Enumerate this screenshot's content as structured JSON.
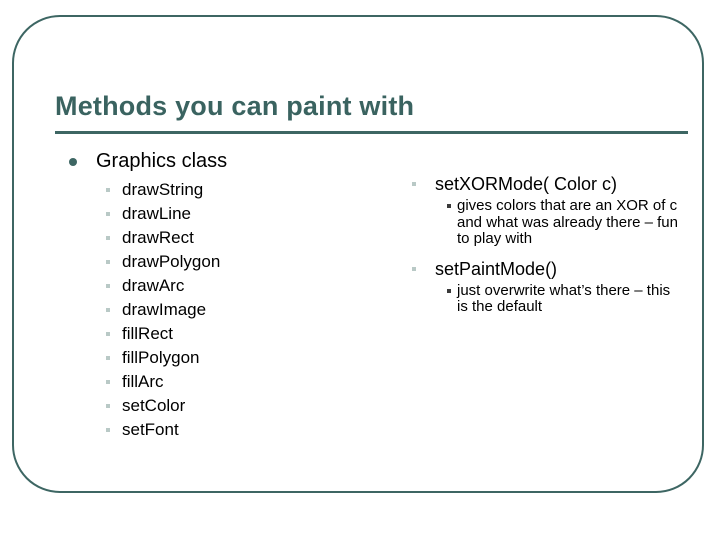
{
  "slide": {
    "title": "Methods you can paint with",
    "accent_color": "#3a6360",
    "frame_color": "#3d6663",
    "bullet_round_color": "#3d6663",
    "bullet_square_color": "#b9c9c6",
    "background_color": "#ffffff"
  },
  "left_column": {
    "heading": "Graphics class",
    "methods": [
      "drawString",
      "drawLine",
      "drawRect",
      "drawPolygon",
      "drawArc",
      "drawImage",
      "fillRect",
      "fillPolygon",
      "fillArc",
      "setColor",
      "setFont"
    ]
  },
  "right_column": {
    "entries": [
      {
        "signature": "setXORMode( Color c)",
        "description": "gives colors that are an XOR of c and what was already there – fun to play with"
      },
      {
        "signature": "setPaintMode()",
        "description": "just overwrite what’s there – this is the default"
      }
    ]
  }
}
